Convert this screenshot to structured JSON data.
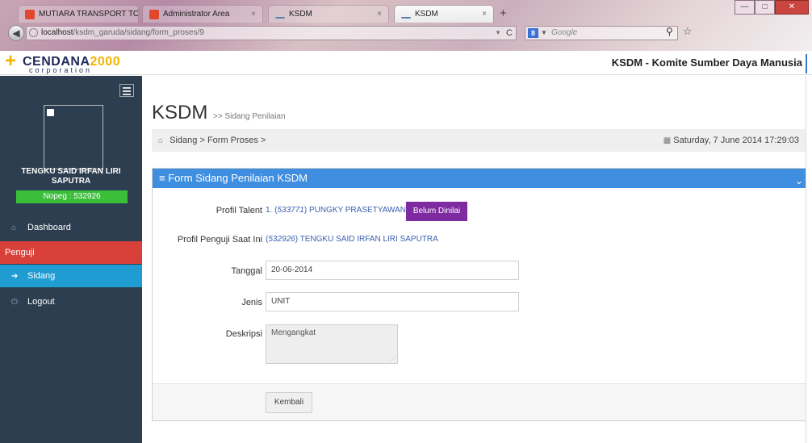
{
  "browser": {
    "tabs": [
      {
        "label": "MUTIARA TRANSPORT TO JOGJA",
        "icon": "favicon-red"
      },
      {
        "label": "Administrator Area",
        "icon": "favicon-red"
      },
      {
        "label": "KSDM",
        "icon": "favicon-page"
      },
      {
        "label": "KSDM",
        "icon": "favicon-page",
        "active": true
      }
    ],
    "url_host": "localhost",
    "url_path": "/ksdm_garuda/sidang/form_proses/9",
    "search_placeholder": "Google",
    "new_tab": "+",
    "close_tab": "×"
  },
  "app": {
    "logo_main": "CENDANA",
    "logo_num": "2000",
    "logo_sub": "corporation",
    "title": "KSDM - Komite Sumber Daya Manusia"
  },
  "sidebar": {
    "user_name": "TENGKU SAID IRFAN LIRI SAPUTRA",
    "nopeg": "Nopeg : 532926",
    "items": [
      {
        "label": "Dashboard",
        "icon": "home-icon"
      },
      {
        "label": "Penguji",
        "icon": ""
      },
      {
        "label": "Sidang",
        "icon": "arrow-circle-right-icon"
      },
      {
        "label": "Logout",
        "icon": "power-icon"
      }
    ]
  },
  "main": {
    "heading": "KSDM",
    "heading_sub": ">> Sidang Penilaian",
    "breadcrumb": [
      "Sidang",
      "Form Proses"
    ],
    "breadcrumb_sep": ">",
    "date": "Saturday, 7 June 2014 17:29:03",
    "panel_title": "Form Sidang Penilaian KSDM",
    "form": {
      "profil_talent_label": "Profil Talent",
      "profil_talent_num": "1.",
      "profil_talent_id": "533771",
      "profil_talent_name": "PUNGKY PRASETYAWAN",
      "status_button": "Belum Dinilai",
      "penguji_label": "Profil Penguji Saat Ini",
      "penguji_id": "532926",
      "penguji_name": "TENGKU SAID IRFAN LIRI SAPUTRA",
      "tanggal_label": "Tanggal",
      "tanggal_value": "20-06-2014",
      "jenis_label": "Jenis",
      "jenis_value": "UNIT",
      "deskripsi_label": "Deskripsi",
      "deskripsi_value": "Mengangkat",
      "back_button": "Kembali"
    }
  },
  "colors": {
    "sidebar_bg": "#2c3e50",
    "panel_head": "#3f8ee0",
    "penguji_bg": "#d9403a",
    "sidang_bg": "#1f9cd2",
    "nopeg_bg": "#3bbf3b",
    "status_button": "#7e2aa0"
  }
}
